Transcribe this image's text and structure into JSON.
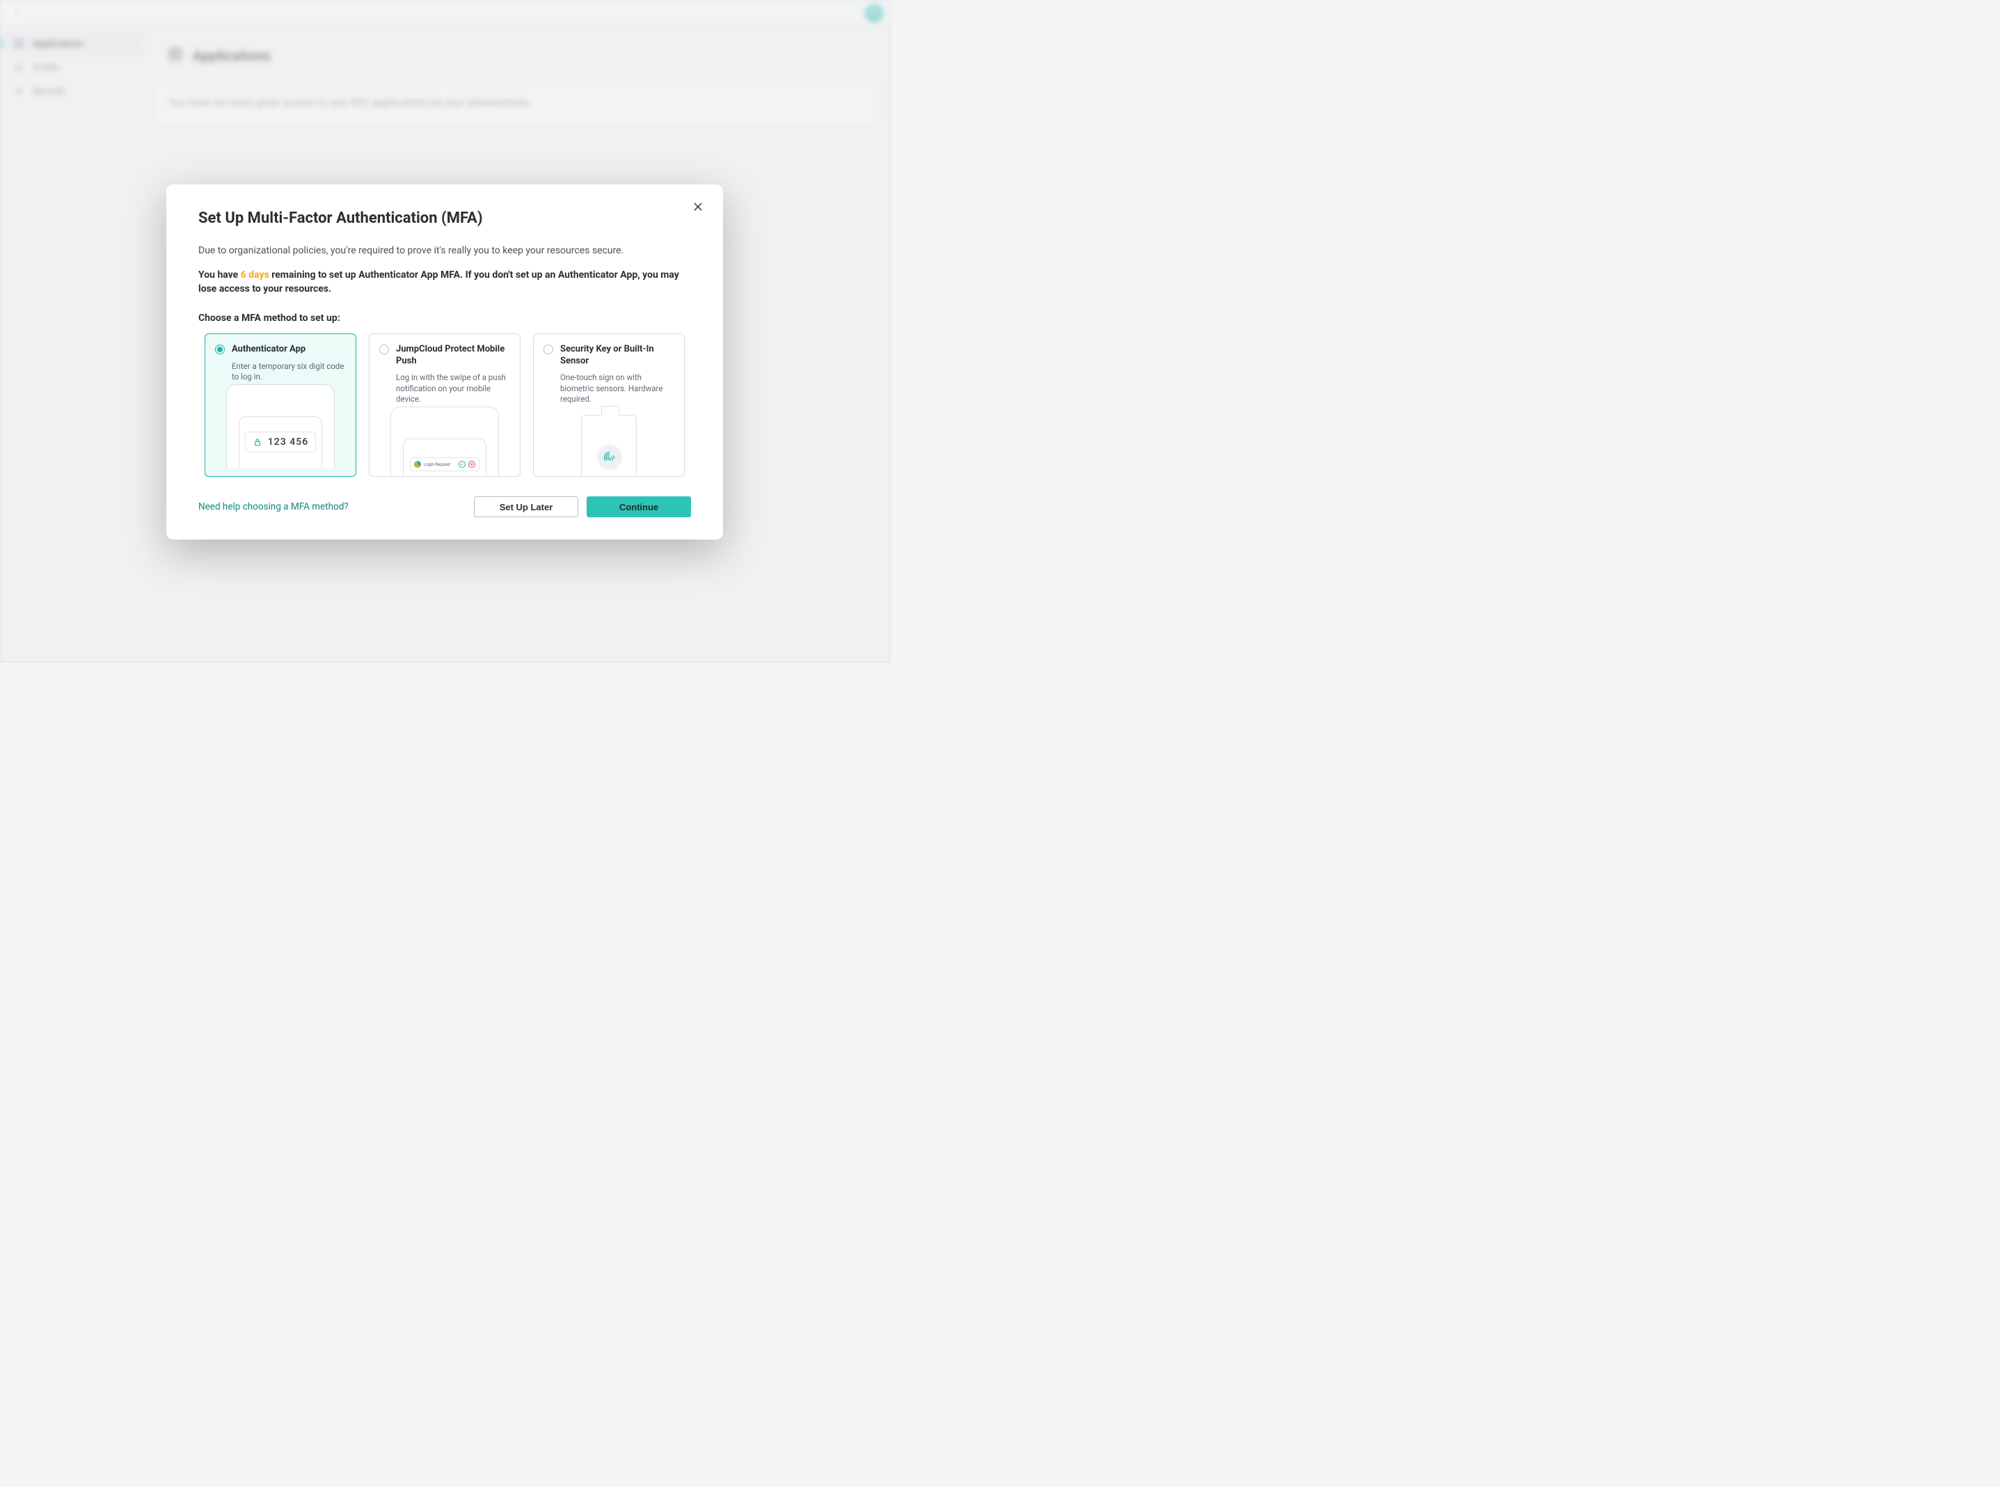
{
  "topbar": {
    "avatar_initials": "UA"
  },
  "sidebar": {
    "items": [
      {
        "label": "Applications",
        "active": true
      },
      {
        "label": "Profile",
        "active": false
      },
      {
        "label": "Security",
        "active": false
      }
    ]
  },
  "page": {
    "title": "Applications",
    "empty_message": "You have not been given access to any SSO applications by your administrator."
  },
  "modal": {
    "title": "Set Up Multi-Factor Authentication (MFA)",
    "intro": "Due to organizational policies, you're required to prove it's really you to keep your resources secure.",
    "warning_prefix": "You have ",
    "warning_days": "6 days",
    "warning_suffix": " remaining to set up Authenticator App MFA. If you don't set up an Authenticator App, you may lose access to your resources.",
    "choose_label": "Choose a MFA method to set up:",
    "options": [
      {
        "title": "Authenticator App",
        "desc": "Enter a temporary six digit code to log in.",
        "selected": true,
        "illus_code": "123 456"
      },
      {
        "title": "JumpCloud Protect Mobile Push",
        "desc": "Log in with the swipe of a push notification on your mobile device.",
        "selected": false,
        "illus_push_label": "Login Request"
      },
      {
        "title": "Security Key or Built-In Sensor",
        "desc": "One-touch sign on with biometric sensors. Hardware required.",
        "selected": false
      }
    ],
    "help_link": "Need help choosing a MFA method?",
    "secondary_button": "Set Up Later",
    "primary_button": "Continue"
  }
}
